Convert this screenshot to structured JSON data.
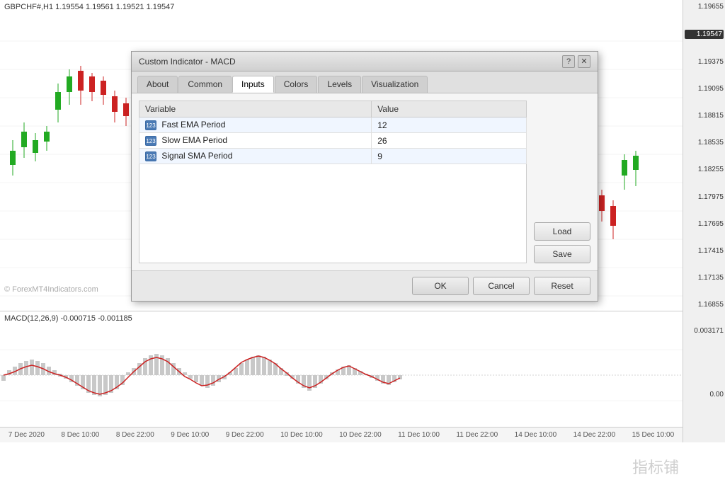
{
  "chart": {
    "title": "GBPCHF#,H1  1.19554  1.19561  1.19521  1.19547",
    "watermark": "© ForexMT4Indicators.com",
    "watermark_cn": "指标铺",
    "macd_label": "MACD(12,26,9) -0.000715 -0.001185",
    "price_labels": [
      "1.19655",
      "1.19547",
      "1.19375",
      "1.19095",
      "1.18815",
      "1.18535",
      "1.18255",
      "1.17975",
      "1.17695",
      "1.17415",
      "1.17135",
      "1.16855"
    ],
    "macd_price_labels": [
      "0.003171",
      "",
      "0.00",
      ""
    ],
    "time_labels": [
      "7 Dec 2020",
      "8 Dec 10:00",
      "8 Dec 22:00",
      "9 Dec 10:00",
      "9 Dec 22:00",
      "10 Dec 10:00",
      "10 Dec 22:00",
      "11 Dec 10:00",
      "11 Dec 22:00",
      "14 Dec 10:00",
      "14 Dec 22:00",
      "15 Dec 10:00"
    ]
  },
  "dialog": {
    "title": "Custom Indicator - MACD",
    "help_label": "?",
    "close_label": "✕",
    "tabs": [
      {
        "id": "about",
        "label": "About"
      },
      {
        "id": "common",
        "label": "Common"
      },
      {
        "id": "inputs",
        "label": "Inputs"
      },
      {
        "id": "colors",
        "label": "Colors"
      },
      {
        "id": "levels",
        "label": "Levels"
      },
      {
        "id": "visualization",
        "label": "Visualization"
      }
    ],
    "active_tab": "inputs",
    "table": {
      "col_variable": "Variable",
      "col_value": "Value",
      "rows": [
        {
          "icon": "123",
          "variable": "Fast EMA Period",
          "value": "12"
        },
        {
          "icon": "123",
          "variable": "Slow EMA Period",
          "value": "26"
        },
        {
          "icon": "123",
          "variable": "Signal SMA Period",
          "value": "9"
        }
      ]
    },
    "buttons": {
      "load": "Load",
      "save": "Save",
      "ok": "OK",
      "cancel": "Cancel",
      "reset": "Reset"
    }
  }
}
